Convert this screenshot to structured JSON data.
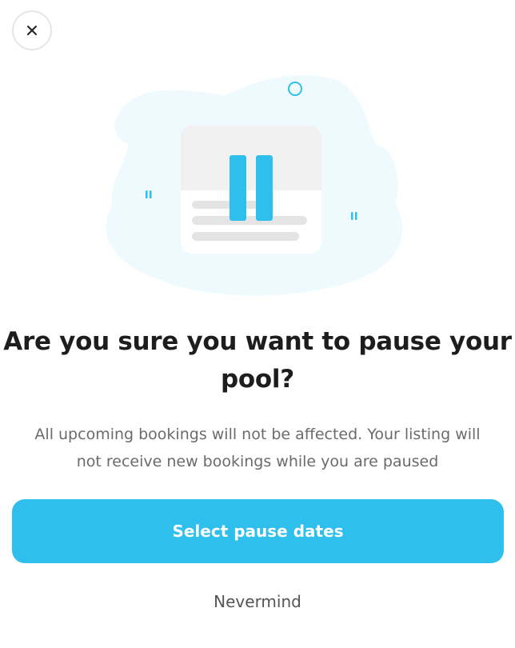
{
  "dialog": {
    "close_icon": "close-icon",
    "illustration_icon": "pause-icon",
    "title": "Are you sure you want to pause your pool?",
    "description": "All upcoming bookings will not be affected. Your listing will not receive new bookings while you are paused",
    "primary_button_label": "Select pause dates",
    "secondary_button_label": "Nevermind"
  },
  "colors": {
    "accent": "#2fbfec",
    "blob": "#eefafe",
    "text_dark": "#1d1d1f",
    "text_muted": "#6b6b6b"
  }
}
